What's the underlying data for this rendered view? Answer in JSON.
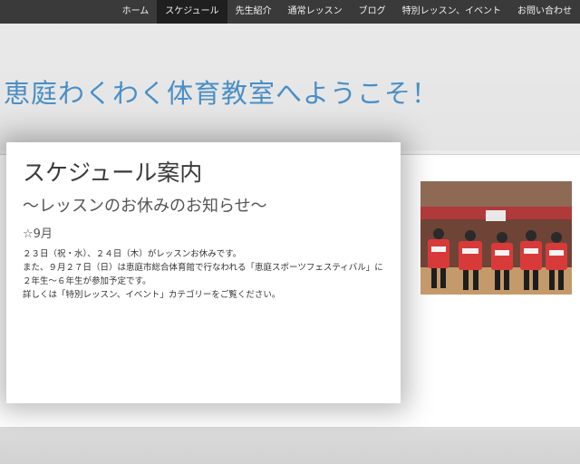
{
  "nav": {
    "items": [
      {
        "label": "ホーム"
      },
      {
        "label": "スケジュール"
      },
      {
        "label": "先生紹介"
      },
      {
        "label": "通常レッスン"
      },
      {
        "label": "ブログ"
      },
      {
        "label": "特別レッスン、イベント"
      },
      {
        "label": "お問い合わせ"
      }
    ],
    "active_index": 1
  },
  "site": {
    "title": "恵庭わくわく体育教室へようこそ！"
  },
  "article": {
    "title": "スケジュール案内",
    "subtitle": "〜レッスンのお休みのお知らせ〜",
    "month": "☆9月",
    "lines": [
      "２３日（祝・水）、２４日（木）がレッスンお休みです。",
      "また、９月２７日（日）は恵庭市総合体育館で行なわれる「恵庭スポーツフェスティバル」に２年生〜６年生が参加予定です。",
      "詳しくは「特別レッスン、イベント」カテゴリーをご覧ください。"
    ]
  },
  "colors": {
    "nav_bg": "#3a3a3a",
    "nav_active": "#1f1f1f",
    "title_blue": "#4a8fc6"
  },
  "photo": {
    "icon": "gym-team-photo"
  }
}
